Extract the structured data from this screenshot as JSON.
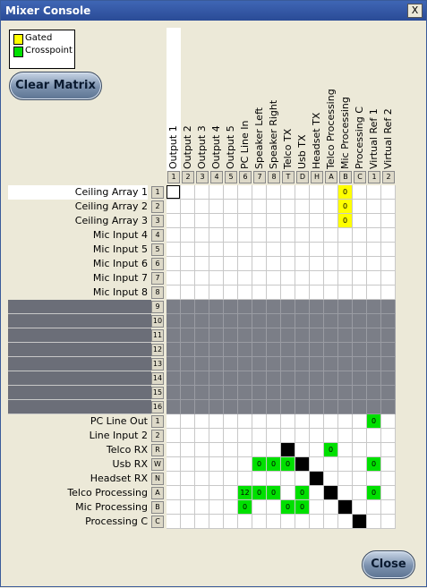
{
  "window": {
    "title": "Mixer Console",
    "close_glyph": "X"
  },
  "legend": [
    {
      "label": "Gated",
      "color": "#ffff00"
    },
    {
      "label": "Crosspoint",
      "color": "#00e000"
    }
  ],
  "buttons": {
    "clear_matrix": "Clear Matrix",
    "close": "Close"
  },
  "columns": [
    {
      "label": "Output 1",
      "num": "1"
    },
    {
      "label": "Output 2",
      "num": "2"
    },
    {
      "label": "Output 3",
      "num": "3"
    },
    {
      "label": "Output 4",
      "num": "4"
    },
    {
      "label": "Output 5",
      "num": "5"
    },
    {
      "label": "PC Line In",
      "num": "6"
    },
    {
      "label": "Speaker Left",
      "num": "7"
    },
    {
      "label": "Speaker Right",
      "num": "8"
    },
    {
      "label": "Telco TX",
      "num": "T"
    },
    {
      "label": "Usb TX",
      "num": "D"
    },
    {
      "label": "Headset TX",
      "num": "H"
    },
    {
      "label": "Telco Processing",
      "num": "A"
    },
    {
      "label": "Mic Processing",
      "num": "B"
    },
    {
      "label": "Processing C",
      "num": "C"
    },
    {
      "label": "Virtual Ref 1",
      "num": "1"
    },
    {
      "label": "Virtual Ref 2",
      "num": "2"
    }
  ],
  "rows": [
    {
      "label": "Ceiling Array 1",
      "num": "1",
      "dark": false,
      "cells": [
        [
          "sel",
          ""
        ],
        null,
        null,
        null,
        null,
        null,
        null,
        null,
        null,
        null,
        null,
        null,
        [
          "gated",
          "0"
        ],
        null,
        null,
        null
      ]
    },
    {
      "label": "Ceiling Array 2",
      "num": "2",
      "dark": false,
      "cells": [
        null,
        null,
        null,
        null,
        null,
        null,
        null,
        null,
        null,
        null,
        null,
        null,
        [
          "gated",
          "0"
        ],
        null,
        null,
        null
      ]
    },
    {
      "label": "Ceiling Array 3",
      "num": "3",
      "dark": false,
      "cells": [
        null,
        null,
        null,
        null,
        null,
        null,
        null,
        null,
        null,
        null,
        null,
        null,
        [
          "gated",
          "0"
        ],
        null,
        null,
        null
      ]
    },
    {
      "label": "Mic Input 4",
      "num": "4",
      "dark": false,
      "cells": []
    },
    {
      "label": "Mic Input 5",
      "num": "5",
      "dark": false,
      "cells": []
    },
    {
      "label": "Mic Input 6",
      "num": "6",
      "dark": false,
      "cells": []
    },
    {
      "label": "Mic Input 7",
      "num": "7",
      "dark": false,
      "cells": []
    },
    {
      "label": "Mic Input 8",
      "num": "8",
      "dark": false,
      "cells": []
    },
    {
      "label": "",
      "num": "9",
      "dark": true,
      "cells": []
    },
    {
      "label": "",
      "num": "10",
      "dark": true,
      "cells": []
    },
    {
      "label": "",
      "num": "11",
      "dark": true,
      "cells": []
    },
    {
      "label": "",
      "num": "12",
      "dark": true,
      "cells": []
    },
    {
      "label": "",
      "num": "13",
      "dark": true,
      "cells": []
    },
    {
      "label": "",
      "num": "14",
      "dark": true,
      "cells": []
    },
    {
      "label": "",
      "num": "15",
      "dark": true,
      "cells": []
    },
    {
      "label": "",
      "num": "16",
      "dark": true,
      "cells": []
    },
    {
      "label": "PC Line Out",
      "num": "1",
      "dark": false,
      "cells": [
        null,
        null,
        null,
        null,
        null,
        null,
        null,
        null,
        null,
        null,
        null,
        null,
        null,
        null,
        [
          "cross",
          "0"
        ],
        null
      ]
    },
    {
      "label": "Line Input 2",
      "num": "2",
      "dark": false,
      "cells": []
    },
    {
      "label": "Telco RX",
      "num": "R",
      "dark": false,
      "cells": [
        null,
        null,
        null,
        null,
        null,
        null,
        null,
        null,
        [
          "black",
          ""
        ],
        null,
        null,
        [
          "cross",
          "0"
        ],
        null,
        null,
        null,
        null
      ]
    },
    {
      "label": "Usb RX",
      "num": "W",
      "dark": false,
      "cells": [
        null,
        null,
        null,
        null,
        null,
        null,
        [
          "cross",
          "0"
        ],
        [
          "cross",
          "0"
        ],
        [
          "cross",
          "0"
        ],
        [
          "black",
          ""
        ],
        null,
        null,
        null,
        null,
        [
          "cross",
          "0"
        ],
        null
      ]
    },
    {
      "label": "Headset RX",
      "num": "N",
      "dark": false,
      "cells": [
        null,
        null,
        null,
        null,
        null,
        null,
        null,
        null,
        null,
        null,
        [
          "black",
          ""
        ],
        null,
        null,
        null,
        null,
        null
      ]
    },
    {
      "label": "Telco Processing",
      "num": "A",
      "dark": false,
      "cells": [
        null,
        null,
        null,
        null,
        null,
        [
          "cross",
          "12"
        ],
        [
          "cross",
          "0"
        ],
        [
          "cross",
          "0"
        ],
        null,
        [
          "cross",
          "0"
        ],
        null,
        [
          "black",
          ""
        ],
        null,
        null,
        [
          "cross",
          "0"
        ],
        null
      ]
    },
    {
      "label": "Mic Processing",
      "num": "B",
      "dark": false,
      "cells": [
        null,
        null,
        null,
        null,
        null,
        [
          "cross",
          "0"
        ],
        null,
        null,
        [
          "cross",
          "0"
        ],
        [
          "cross",
          "0"
        ],
        null,
        null,
        [
          "black",
          ""
        ],
        null,
        null,
        null
      ]
    },
    {
      "label": "Processing C",
      "num": "C",
      "dark": false,
      "cells": [
        null,
        null,
        null,
        null,
        null,
        null,
        null,
        null,
        null,
        null,
        null,
        null,
        null,
        [
          "black",
          ""
        ],
        null,
        null
      ]
    }
  ]
}
